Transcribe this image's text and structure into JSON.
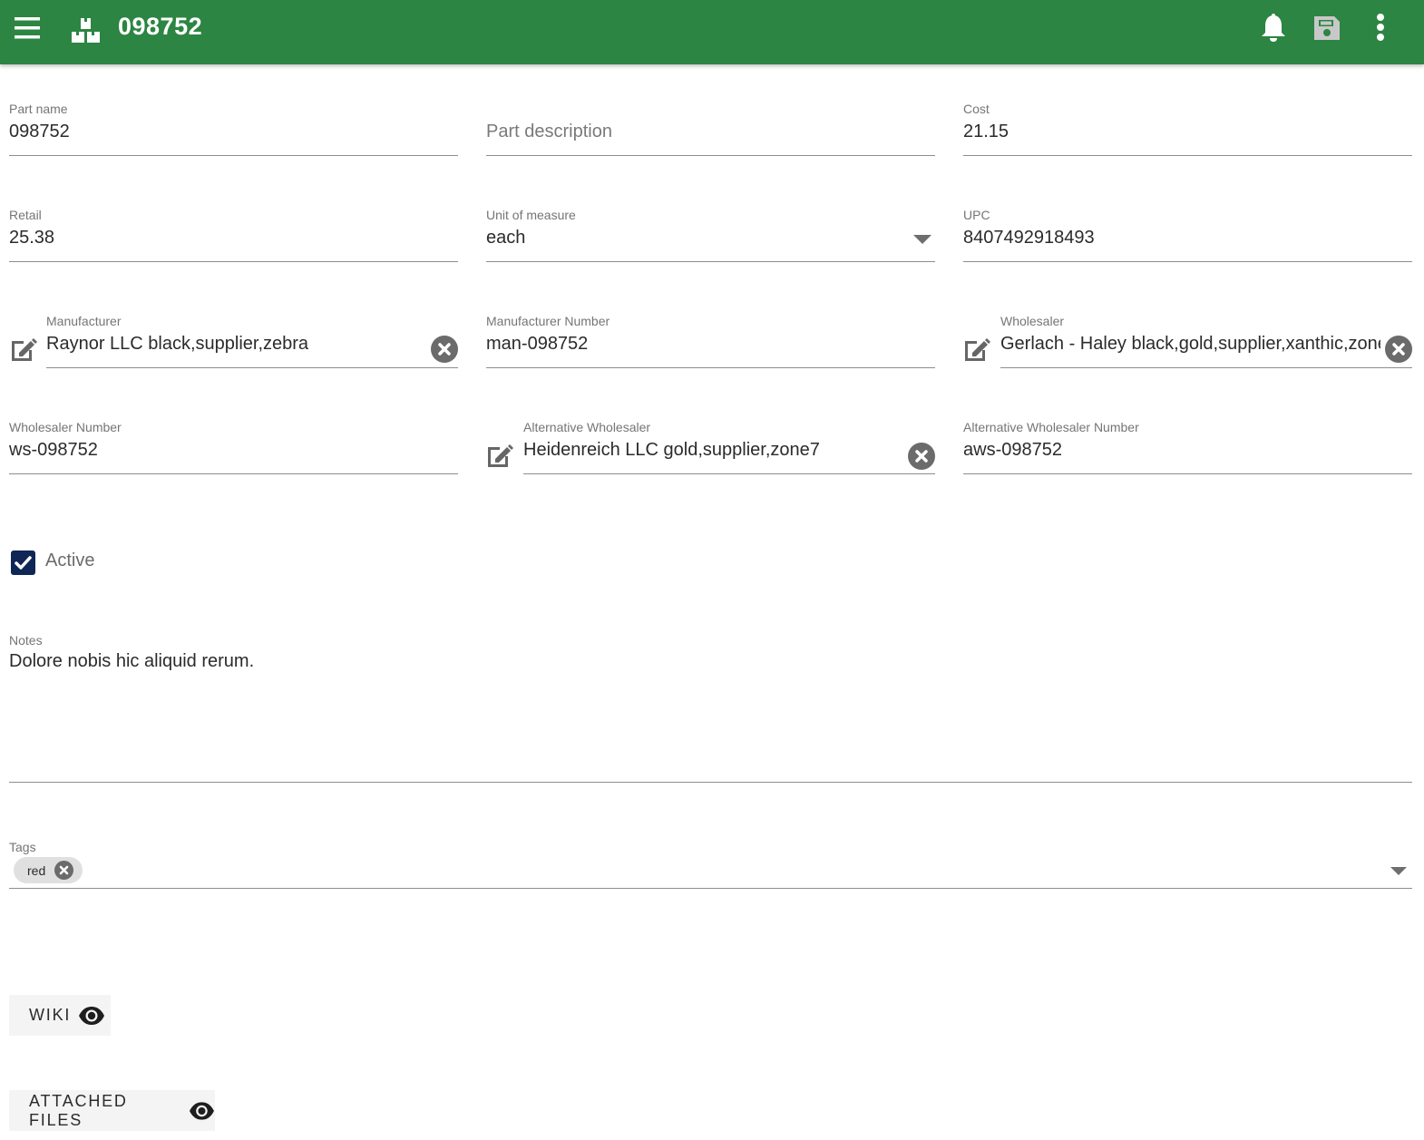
{
  "appbar": {
    "title": "098752",
    "icons": {
      "menu": "menu-icon",
      "logo": "boxes-icon",
      "notifications": "bell-icon",
      "save": "save-icon",
      "more": "more-vert-icon"
    },
    "save_disabled": true,
    "color": "#2c8542"
  },
  "form": {
    "part_name": {
      "label": "Part name",
      "value": "098752"
    },
    "part_description": {
      "placeholder": "Part description",
      "value": ""
    },
    "cost": {
      "label": "Cost",
      "value": "21.15"
    },
    "retail": {
      "label": "Retail",
      "value": "25.38"
    },
    "unit_of_measure": {
      "label": "Unit of measure",
      "value": "each"
    },
    "upc": {
      "label": "UPC",
      "value": "8407492918493"
    },
    "manufacturer": {
      "label": "Manufacturer",
      "value": "Raynor LLC black,supplier,zebra"
    },
    "manufacturer_number": {
      "label": "Manufacturer Number",
      "value": "man-098752"
    },
    "wholesaler": {
      "label": "Wholesaler",
      "value": "Gerlach - Haley black,gold,supplier,xanthic,zone"
    },
    "wholesaler_number": {
      "label": "Wholesaler Number",
      "value": "ws-098752"
    },
    "alternative_wholesaler": {
      "label": "Alternative Wholesaler",
      "value": "Heidenreich LLC gold,supplier,zone7"
    },
    "alternative_wholesaler_number": {
      "label": "Alternative Wholesaler Number",
      "value": "aws-098752"
    },
    "active": {
      "label": "Active",
      "checked": true
    },
    "notes": {
      "label": "Notes",
      "value": "Dolore nobis hic aliquid rerum."
    },
    "tags": {
      "label": "Tags",
      "items": [
        {
          "label": "red"
        }
      ]
    }
  },
  "buttons": {
    "wiki": {
      "label": "WIKI",
      "icon": "eye-icon"
    },
    "attached_files": {
      "label": "ATTACHED FILES",
      "icon": "eye-icon"
    }
  }
}
